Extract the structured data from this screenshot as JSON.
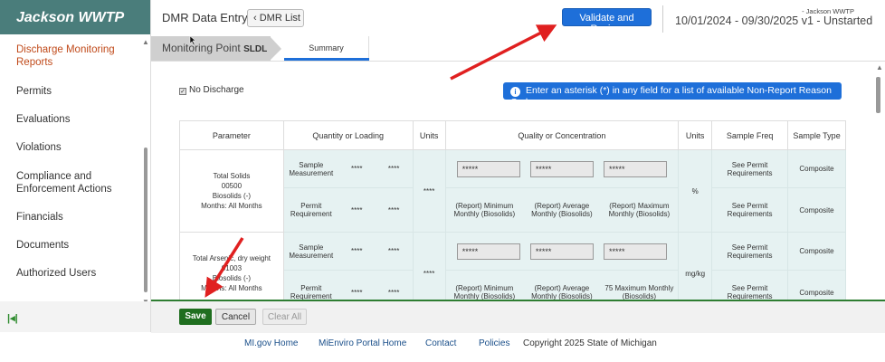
{
  "brand": "Jackson WWTP",
  "sidebar": {
    "items": [
      {
        "label": "Discharge Monitoring Reports",
        "active": true
      },
      {
        "label": "Permits"
      },
      {
        "label": "Evaluations"
      },
      {
        "label": "Violations"
      },
      {
        "label": "Compliance and Enforcement Actions"
      },
      {
        "label": "Financials"
      },
      {
        "label": "Documents"
      },
      {
        "label": "Authorized Users"
      }
    ]
  },
  "header": {
    "title": "DMR Data Entry",
    "back_label": "DMR List",
    "validate_label": "Validate and Review",
    "facility": "- Jackson WWTP",
    "period": "10/01/2024 - 09/30/2025 v1 - Unstarted"
  },
  "tabs": {
    "monitoring_point_label": "Monitoring Point",
    "monitoring_point_value": "SLDL",
    "summary_label": "Summary"
  },
  "form": {
    "no_discharge_label": "No Discharge",
    "info_banner": "Enter an asterisk (*) in any field for a list of available Non-Report Reason Codes"
  },
  "table": {
    "headers": {
      "parameter": "Parameter",
      "quantity": "Quantity or Loading",
      "units1": "Units",
      "quality": "Quality or Concentration",
      "units2": "Units",
      "sample_freq": "Sample Freq",
      "sample_type": "Sample Type"
    },
    "rows": [
      {
        "param_lines": [
          "Total Solids",
          "00500",
          "Biosolids (-)",
          "Months: All Months"
        ],
        "qty_units": "****",
        "qual_units": "%",
        "sample": {
          "label": "Sample Measurement",
          "q1": "****",
          "q2": "****",
          "c1": "*****",
          "c2": "*****",
          "c3": "*****",
          "freq": "See Permit Requirements",
          "type": "Composite"
        },
        "permit": {
          "label": "Permit Requirement",
          "q1": "****",
          "q2": "****",
          "c1": "(Report) Minimum Monthly (Biosolids)",
          "c2": "(Report) Average Monthly (Biosolids)",
          "c3": "(Report) Maximum Monthly (Biosolids)",
          "freq": "See Permit Requirements",
          "type": "Composite"
        }
      },
      {
        "param_lines": [
          "Total Arsenic, dry weight",
          "01003",
          "Biosolids (-)",
          "Months: All Months"
        ],
        "qty_units": "****",
        "qual_units": "mg/kg",
        "sample": {
          "label": "Sample Measurement",
          "q1": "****",
          "q2": "****",
          "c1": "*****",
          "c2": "*****",
          "c3": "*****",
          "freq": "See Permit Requirements",
          "type": "Composite"
        },
        "permit": {
          "label": "Permit Requirement",
          "q1": "****",
          "q2": "****",
          "c1": "(Report) Minimum Monthly (Biosolids)",
          "c2": "(Report) Average Monthly (Biosolids)",
          "c3": "75 Maximum Monthly (Biosolids)",
          "freq": "See Permit Requirements",
          "type": "Composite"
        }
      }
    ]
  },
  "actions": {
    "save": "Save",
    "cancel": "Cancel",
    "clear": "Clear All"
  },
  "footer": {
    "links": [
      "MI.gov Home",
      "MiEnviro Portal Home",
      "Contact",
      "Policies"
    ],
    "copyright": "Copyright 2025 State of Michigan"
  },
  "colors": {
    "brand": "#4a7d7b",
    "accent": "#1e6fd9",
    "save": "#1f6e1f",
    "annotation": "#e02020"
  }
}
